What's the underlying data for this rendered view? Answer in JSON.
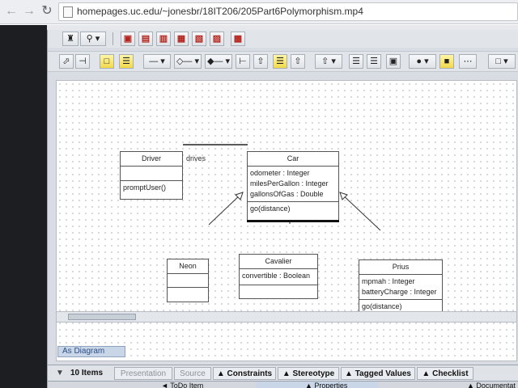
{
  "browser": {
    "url": "homepages.uc.edu/~jonesbr/18IT206/205Part6Polymorphism.mp4"
  },
  "toolbar": {
    "binoculars_label": "♜",
    "zoom_label": "⚲ ▾"
  },
  "diagram": {
    "classes": [
      {
        "id": "driver",
        "name": "Driver",
        "attributes": [],
        "operations": [
          "promptUser()"
        ]
      },
      {
        "id": "car",
        "name": "Car",
        "attributes": [
          "odometer : Integer",
          "milesPerGallon : Integer",
          "gallonsOfGas : Double"
        ],
        "operations": [
          "go(distance)"
        ]
      },
      {
        "id": "neon",
        "name": "Neon",
        "attributes": [],
        "operations": []
      },
      {
        "id": "cavalier",
        "name": "Cavalier",
        "attributes": [
          "convertible : Boolean"
        ],
        "operations": []
      },
      {
        "id": "prius",
        "name": "Prius",
        "attributes": [
          "mpmah : Integer",
          "batteryCharge : Integer"
        ],
        "operations": [
          "go(distance)"
        ]
      }
    ],
    "association_label": "drives",
    "diagram_tab": "As Diagram"
  },
  "details": {
    "item_count": "10 Items",
    "tabs": [
      "Presentation",
      "Source",
      "▲ Constraints",
      "▲ Stereotype",
      "▲ Tagged Values",
      "▲ Checklist"
    ],
    "bottom_tabs": [
      "◄ ToDo Item",
      "▲ Properties",
      "▲ Documentat"
    ]
  }
}
